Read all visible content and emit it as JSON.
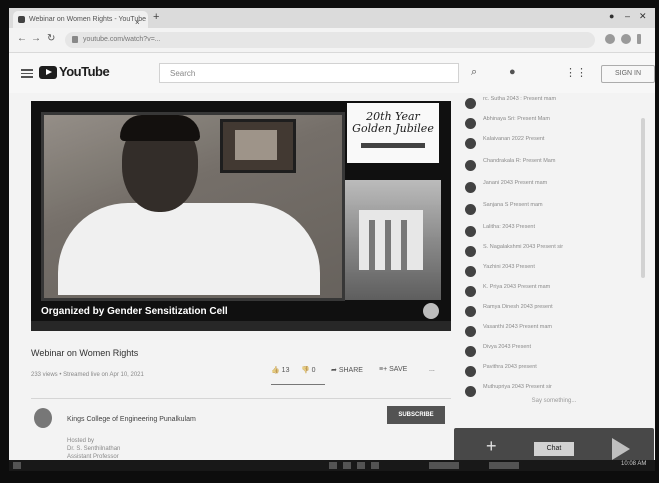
{
  "browser": {
    "tab_title": "Webinar on Women Rights - YouTube",
    "address": "youtube.com/watch?v=...",
    "new_tab": "+",
    "tab_close": "×"
  },
  "youtube": {
    "logo": "YouTube",
    "search_placeholder": "Search",
    "sign_in": "SIGN IN"
  },
  "video": {
    "logo_line1": "20th Year",
    "logo_line2": "Golden Jubilee",
    "caption": "Organized by Gender Sensitization Cell",
    "title": "Webinar on Women Rights",
    "meta": "233 views • Streamed live on Apr 10, 2021",
    "likes": "13",
    "dislikes": "0",
    "share": "SHARE",
    "save": "SAVE",
    "more": "..."
  },
  "channel": {
    "name": "Kings College of Engineering Punalkulam",
    "subscribe": "SUBSCRIBE",
    "desc": [
      "Hosted by",
      "Dr. S. Senthilnathan",
      "Assistant Professor"
    ]
  },
  "chat": {
    "messages": [
      "rc. Sutha 2043 : Present mam",
      "Abhinaya Sri: Present Mam",
      "Kalaivanan 2022 Present",
      "Chandrakala R: Present Mam",
      "Janani 2043 Present mam",
      "Sanjana S Present mam",
      "Lalitha: 2043 Present",
      "S. Nagalakshmi 2043 Present sir",
      "Yazhini 2043 Present",
      "K. Priya 2043 Present mam",
      "Ramya Dinesh 2043 present",
      "Vasanthi 2043 Present mam",
      "Divya 2043 Present",
      "Pavithra 2043 present",
      "Muthupriya 2043 Present sir"
    ],
    "footer": "Say something..."
  },
  "overlay": {
    "chip": "Chat"
  },
  "taskbar": {
    "clock": "10:08 AM"
  }
}
